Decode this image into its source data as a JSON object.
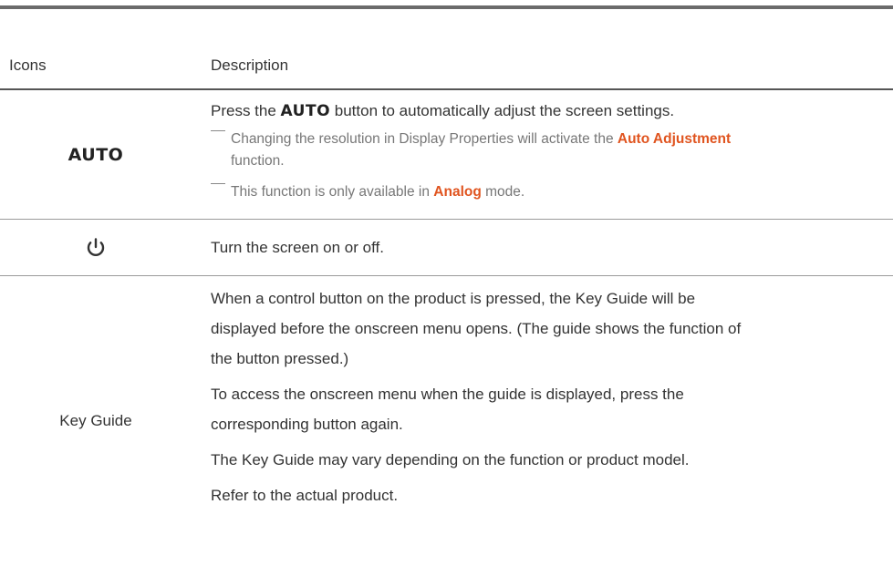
{
  "table": {
    "header": {
      "icons": "Icons",
      "description": "Description"
    },
    "rows": [
      {
        "icon_text": "AUTO",
        "desc_before": "Press the ",
        "desc_bold": "AUTO",
        "desc_after": " button to automatically adjust the screen settings.",
        "note1_before": "Changing the resolution in Display Properties will activate the ",
        "note1_highlight": "Auto Adjustment",
        "note1_after": "function.",
        "note2_before": "This function is only available in ",
        "note2_highlight": "Analog",
        "note2_after": " mode."
      },
      {
        "icon_semantic": "power-icon",
        "desc": "Turn the screen on or off."
      },
      {
        "label": "Key Guide",
        "paragraphs": [
          "When a control button on the product is pressed, the Key Guide will be",
          "displayed before the onscreen menu opens. (The guide shows the function of",
          "the button pressed.)",
          "To access the onscreen menu when the guide is displayed, press the",
          "corresponding button again.",
          "The Key Guide may vary depending on the function or product model.",
          "Refer to the actual product."
        ]
      }
    ]
  },
  "colors": {
    "highlight": "#e0541f",
    "text": "#333333",
    "note": "#777777",
    "rule": "#9a9a9a"
  }
}
